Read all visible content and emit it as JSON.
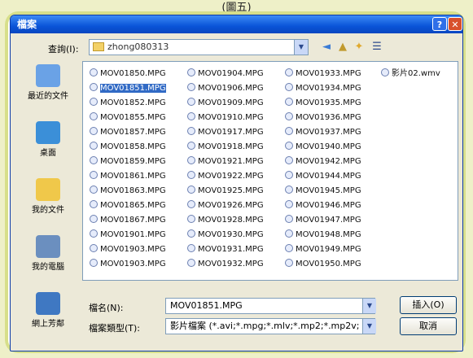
{
  "caption": "(圖五)",
  "dialog": {
    "title": "檔案",
    "lookin_label": "查詢(I):",
    "current_folder": "zhong080313"
  },
  "places": [
    {
      "label": "最近的文件",
      "icon": "recent-documents-icon",
      "color": "#6aa2e6"
    },
    {
      "label": "桌面",
      "icon": "desktop-icon",
      "color": "#3b8fd8"
    },
    {
      "label": "我的文件",
      "icon": "my-documents-icon",
      "color": "#f0c84a"
    },
    {
      "label": "我的電腦",
      "icon": "my-computer-icon",
      "color": "#6b8fbf"
    },
    {
      "label": "網上芳鄰",
      "icon": "network-places-icon",
      "color": "#3f78c2"
    }
  ],
  "files": {
    "col1": [
      "MOV01850.MPG",
      "MOV01851.MPG",
      "MOV01852.MPG",
      "MOV01855.MPG",
      "MOV01857.MPG",
      "MOV01858.MPG",
      "MOV01859.MPG",
      "MOV01861.MPG",
      "MOV01863.MPG",
      "MOV01865.MPG",
      "MOV01867.MPG",
      "MOV01901.MPG",
      "MOV01903.MPG",
      "MOV01903.MPG"
    ],
    "col2": [
      "MOV01904.MPG",
      "MOV01906.MPG",
      "MOV01909.MPG",
      "MOV01910.MPG",
      "MOV01917.MPG",
      "MOV01918.MPG",
      "MOV01921.MPG",
      "MOV01922.MPG",
      "MOV01925.MPG",
      "MOV01926.MPG",
      "MOV01928.MPG",
      "MOV01930.MPG",
      "MOV01931.MPG",
      "MOV01932.MPG"
    ],
    "col3": [
      "MOV01933.MPG",
      "MOV01934.MPG",
      "MOV01935.MPG",
      "MOV01936.MPG",
      "MOV01937.MPG",
      "MOV01940.MPG",
      "MOV01942.MPG",
      "MOV01944.MPG",
      "MOV01945.MPG",
      "MOV01946.MPG",
      "MOV01947.MPG",
      "MOV01948.MPG",
      "MOV01949.MPG",
      "MOV01950.MPG"
    ],
    "col4": [
      "影片02.wmv"
    ],
    "selected": "MOV01851.MPG"
  },
  "filename_label": "檔名(N):",
  "filename_value": "MOV01851.MPG",
  "filetype_label": "檔案類型(T):",
  "filetype_value": "影片檔案 (*.avi;*.mpg;*.mlv;*.mp2;*.mp2v;",
  "open_button": "插入(O)",
  "cancel_button": "取消"
}
